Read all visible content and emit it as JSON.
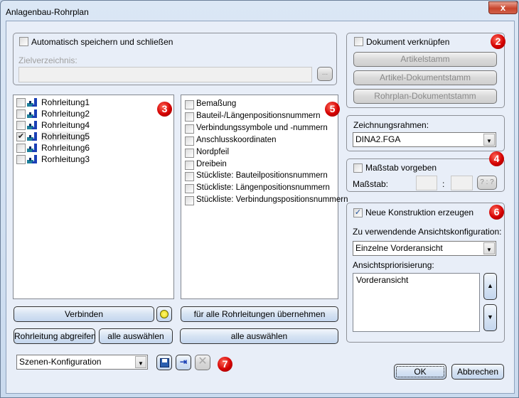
{
  "window": {
    "title": "Anlagenbau-Rohrplan",
    "close_label": "x"
  },
  "autosave": {
    "checkbox_label": "Automatisch speichern und schließen",
    "checked": false,
    "target_label": "Zielverzeichnis:",
    "target_value": "",
    "browse_label": "..."
  },
  "document": {
    "checkbox_label": "Dokument verknüpfen",
    "checked": false,
    "buttons": [
      "Artikelstamm",
      "Artikel-Dokumentstamm",
      "Rohrplan-Dokumentstamm"
    ],
    "badge": "2"
  },
  "frame": {
    "label": "Zeichnungsrahmen:",
    "value": "DINA2.FGA"
  },
  "scale": {
    "checkbox_label": "Maßstab vorgeben",
    "checked": false,
    "label": "Maßstab:",
    "separator": ":",
    "button_label": "? : ?",
    "badge": "4"
  },
  "construction": {
    "checkbox_label": "Neue Konstruktion erzeugen",
    "checked": true,
    "config_label": "Zu verwendende Ansichtskonfiguration:",
    "config_value": "Einzelne Vorderansicht",
    "priority_label": "Ansichtspriorisierung:",
    "priority_items": [
      "Vorderansicht"
    ],
    "badge": "6"
  },
  "pipelines": {
    "badge": "3",
    "items": [
      {
        "label": "Rohrleitung1",
        "checked": false
      },
      {
        "label": "Rohrleitung2",
        "checked": false
      },
      {
        "label": "Rohrleitung4",
        "checked": false
      },
      {
        "label": "Rohrleitung5",
        "checked": true
      },
      {
        "label": "Rohrleitung6",
        "checked": false
      },
      {
        "label": "Rorhleitung3",
        "checked": false
      }
    ]
  },
  "options": {
    "badge": "5",
    "items": [
      "Bemaßung",
      "Bauteil-/Längenpositionsnummern",
      "Verbindungssymbole und -nummern",
      "Anschlusskoordinaten",
      "Nordpfeil",
      "Dreibein",
      "Stückliste: Bauteilpositionsnummern",
      "Stückliste: Längenpositionsnummern",
      "Stückliste: Verbindungspositionsnummern"
    ]
  },
  "buttons": {
    "connect": "Verbinden",
    "apply_all": "für alle Rohrleitungen übernehmen",
    "pick_pipe": "Rohrleitung abgreifen",
    "select_all_left": "alle auswählen",
    "select_all_right": "alle auswählen",
    "ok": "OK",
    "cancel": "Abbrechen"
  },
  "scene": {
    "value": "Szenen-Konfiguration",
    "badge": "7"
  },
  "colors": {
    "badge": "#d40000",
    "accent": "#1f4f9a"
  }
}
